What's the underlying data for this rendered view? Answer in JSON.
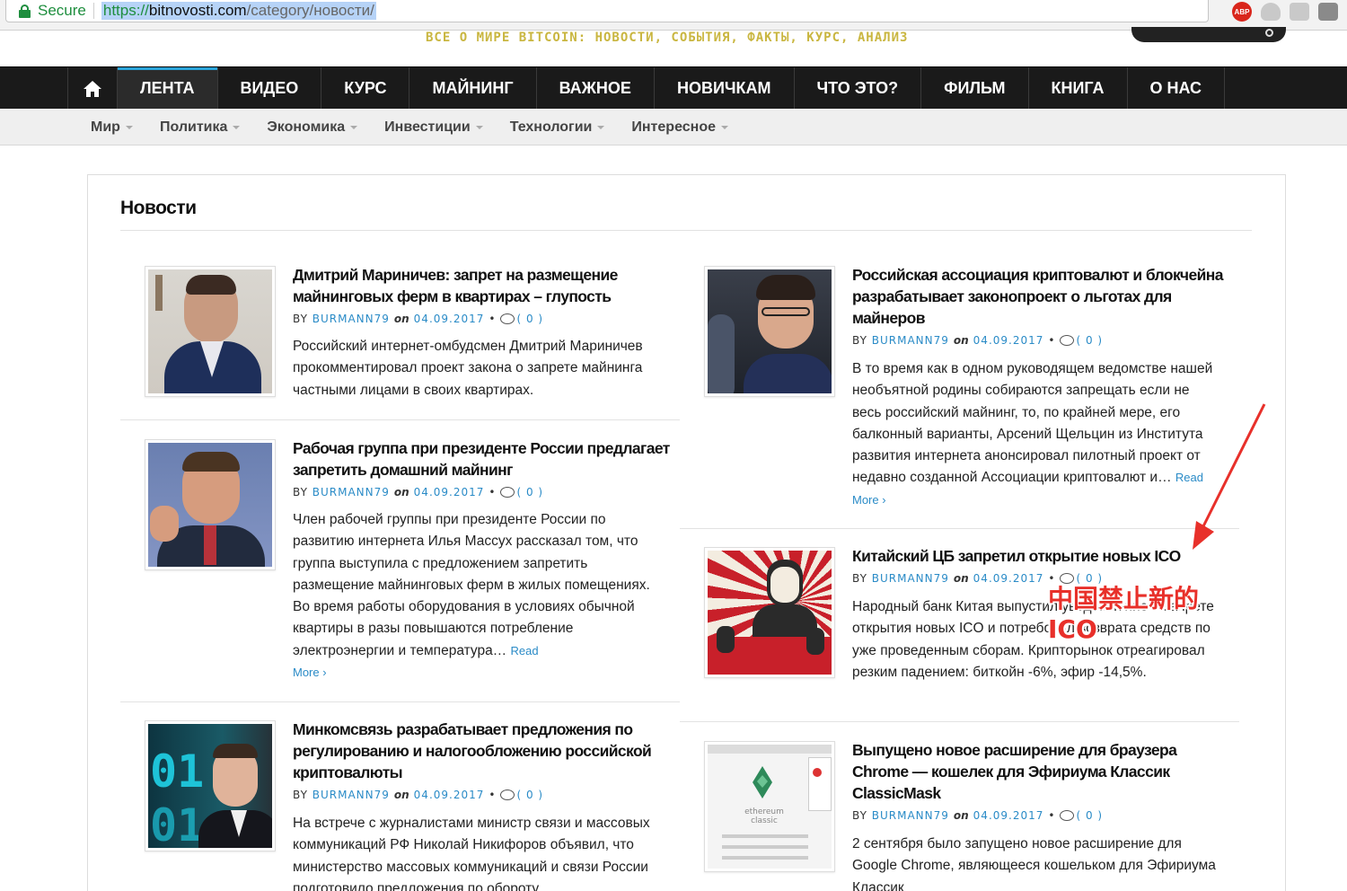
{
  "browser": {
    "secure_label": "Secure",
    "url_scheme": "https://",
    "url_host": "bitnovosti.com",
    "url_path": "/category/новости/",
    "extension_abp": "ABP"
  },
  "site": {
    "tagline": "ВСЕ О МИРЕ BITCOIN: НОВОСТИ, СОБЫТИЯ, ФАКТЫ, КУРС, АНАЛИЗ"
  },
  "main_nav": [
    "ЛЕНТА",
    "ВИДЕО",
    "КУРС",
    "МАЙНИНГ",
    "ВАЖНОЕ",
    "НОВИЧКАМ",
    "ЧТО ЭТО?",
    "ФИЛЬМ",
    "КНИГА",
    "О НАС"
  ],
  "sub_nav": [
    "Мир",
    "Политика",
    "Экономика",
    "Инвестиции",
    "Технологии",
    "Интересное"
  ],
  "page": {
    "section_title": "Новости"
  },
  "meta": {
    "by": "BY",
    "on": "on",
    "author": "BURMANN79",
    "date": "04.09.2017",
    "comments": "( 0 )"
  },
  "read_more": {
    "read": "Read",
    "more": "More ›",
    "full": "Read More ›"
  },
  "posts": [
    {
      "title": "Дмитрий Мариничев: запрет на размещение майнинговых ферм в квартирах – глупость",
      "excerpt": "Российский интернет-омбудсмен Дмитрий Мариничев прокомментировал проект закона о запрете майнинга частными лицами в своих квартирах."
    },
    {
      "title": "Рабочая группа при президенте России предлагает запретить домашний майнинг",
      "excerpt": "Член рабочей группы при президенте России по развитию интернета Илья Массух рассказал том, что группа выступила с предложением запретить размещение майнинговых ферм в жилых помещениях. Во время работы оборудования в условиях обычной квартиры в разы повышаются потребление электроэнергии и температура…"
    },
    {
      "title": "Минкомсвязь разрабатывает предложения по регулированию и налогообложению российской криптовалюты",
      "excerpt": "На встрече с журналистами министр связи и массовых коммуникаций РФ Николай Никифоров объявил, что министерство массовых коммуникаций и связи России подготовило предложения по обороту"
    },
    {
      "title": "Российская ассоциация криптовалют и блокчейна разрабатывает законопроект о льготах для майнеров",
      "excerpt": "В то время как в одном руководящем ведомстве нашей необъятной родины собираются запрещать если не весь российский майнинг, то, по крайней мере, его балконный варианты, Арсений Щельцин из Института развития интернета анонсировал пилотный проект от недавно созданной Ассоциации криптовалют и…"
    },
    {
      "title": "Китайский ЦБ запретил открытие новых ICO",
      "excerpt": "Народный банк Китая выпустил уведомление о запрете открытия новых ICO и потребовал возврата средств по уже проведенным сборам. Крипторынок отреагировал резким падением: биткойн -6%, эфир -14,5%."
    },
    {
      "title": "Выпущено новое расширение для браузера Chrome — кошелек для Эфириума Классик ClassicMask",
      "excerpt": "2 сентября было запущено новое расширение для Google Chrome, являющееся кошельком для Эфириума Классик"
    }
  ],
  "annotation": {
    "line1": "中国禁止新的",
    "line2": "ICO"
  },
  "thumb_text": {
    "eth_line1": "ethereum",
    "eth_line2": "classic",
    "code": "01"
  },
  "colors": {
    "accent": "#2a8bc7",
    "nav_bg": "#1a1a1a",
    "active_bar": "#2aa3d8",
    "annotation": "#e8302a",
    "tagline": "#c9b640"
  }
}
